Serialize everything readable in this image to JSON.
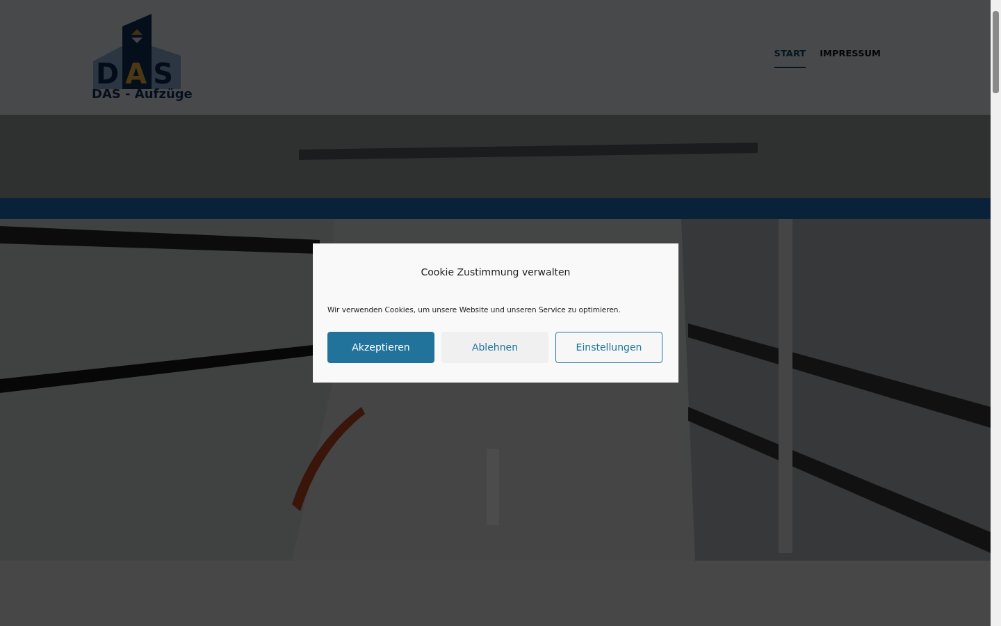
{
  "header": {
    "logo": {
      "letters": "DAS",
      "name": "DAS - Aufzüge"
    },
    "nav": [
      {
        "label": "START",
        "selected": true
      },
      {
        "label": "IMPRESSUM",
        "selected": false
      }
    ]
  },
  "cookie_dialog": {
    "title": "Cookie Zustimmung verwalten",
    "text": "Wir verwenden Cookies, um unsere Website und unseren Service zu optimieren.",
    "buttons": [
      {
        "label": "Akzeptieren",
        "kind": "primary"
      },
      {
        "label": "Ablehnen",
        "kind": "secondary"
      },
      {
        "label": "Einstellungen",
        "kind": "outline"
      }
    ]
  }
}
